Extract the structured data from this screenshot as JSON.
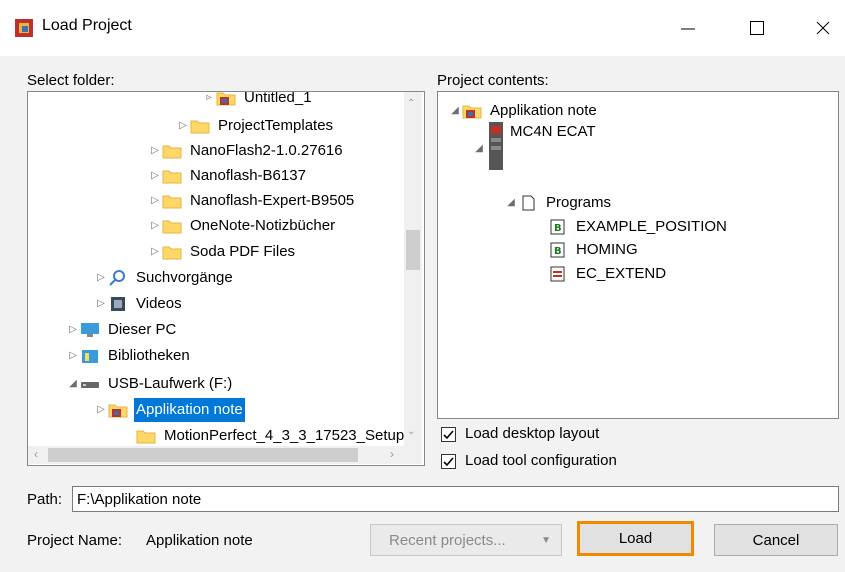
{
  "window": {
    "title": "Load Project"
  },
  "left": {
    "label": "Select folder:",
    "tree": [
      {
        "label": "Untitled_1",
        "kind": "project",
        "tri": "▹"
      },
      {
        "label": "ProjectTemplates",
        "kind": "folder",
        "tri": "▷"
      },
      {
        "label": "NanoFlash2-1.0.27616",
        "kind": "folder",
        "tri": "▷"
      },
      {
        "label": "Nanoflash-B6137",
        "kind": "folder",
        "tri": "▷"
      },
      {
        "label": "Nanoflash-Expert-B9505",
        "kind": "folder",
        "tri": "▷"
      },
      {
        "label": "OneNote-Notizbücher",
        "kind": "folder",
        "tri": "▷"
      },
      {
        "label": "Soda PDF Files",
        "kind": "folder",
        "tri": "▷"
      },
      {
        "label": "Suchvorgänge",
        "kind": "search",
        "tri": "▷"
      },
      {
        "label": "Videos",
        "kind": "video",
        "tri": "▷"
      },
      {
        "label": "Dieser PC",
        "kind": "pc",
        "tri": "▷"
      },
      {
        "label": "Bibliotheken",
        "kind": "library",
        "tri": "▷"
      },
      {
        "label": "USB-Laufwerk (F:)",
        "kind": "drive",
        "tri": "◢"
      },
      {
        "label": "Applikation note",
        "kind": "project",
        "tri": "▷",
        "selected": true
      },
      {
        "label": "MotionPerfect_4_3_3_17523_Setup",
        "kind": "folder",
        "tri": ""
      }
    ]
  },
  "right": {
    "label": "Project contents:",
    "tree": [
      {
        "label": "Applikation note",
        "kind": "project",
        "tri": "◢"
      },
      {
        "label": "MC4N ECAT",
        "kind": "controller",
        "tri": "◢"
      },
      {
        "label": "Programs",
        "kind": "doc",
        "tri": "◢"
      },
      {
        "label": "EXAMPLE_POSITION",
        "kind": "basic",
        "tri": ""
      },
      {
        "label": "HOMING",
        "kind": "basic",
        "tri": ""
      },
      {
        "label": "EC_EXTEND",
        "kind": "ec",
        "tri": ""
      }
    ],
    "load_desktop_layout": "Load desktop layout",
    "load_tool_configuration": "Load tool configuration"
  },
  "path": {
    "label": "Path:",
    "value": "F:\\Applikation note"
  },
  "project_name": {
    "label": "Project Name:",
    "value": "Applikation note"
  },
  "buttons": {
    "recent": "Recent projects...",
    "load": "Load",
    "cancel": "Cancel"
  },
  "colors": {
    "selection": "#0078d7",
    "folder": "#ffd766",
    "focus": "#f08a00",
    "project": "#c0302a"
  }
}
